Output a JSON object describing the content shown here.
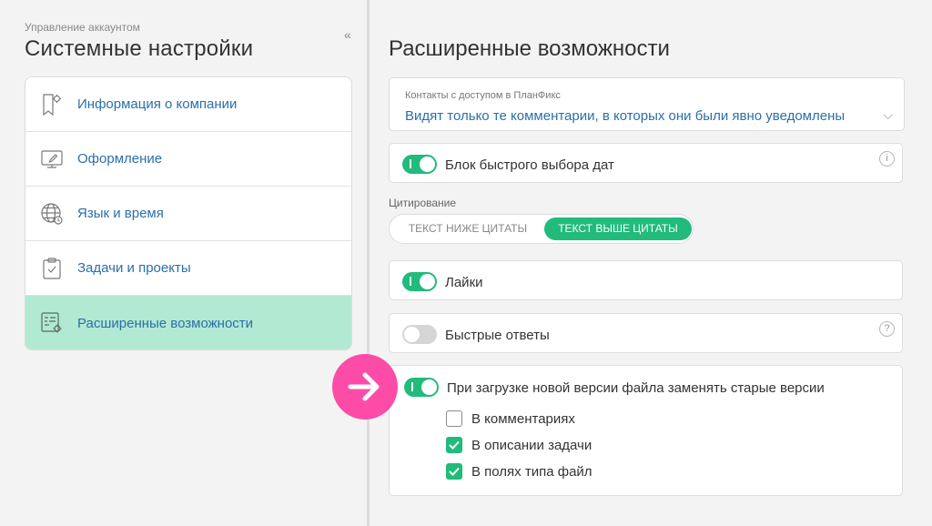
{
  "left": {
    "breadcrumb": "Управление аккаунтом",
    "collapse_glyph": "«",
    "title": "Системные настройки",
    "menu": [
      {
        "label": "Информация о компании",
        "icon": "company-info-icon",
        "active": false
      },
      {
        "label": "Оформление",
        "icon": "appearance-icon",
        "active": false
      },
      {
        "label": "Язык и время",
        "icon": "globe-icon",
        "active": false
      },
      {
        "label": "Задачи и проекты",
        "icon": "clipboard-check-icon",
        "active": false
      },
      {
        "label": "Расширенные возможности",
        "icon": "advanced-settings-icon",
        "active": true
      }
    ]
  },
  "right": {
    "title": "Расширенные возможности",
    "contacts_select": {
      "caption": "Контакты с доступом в ПланФикс",
      "value": "Видят только те комментарии, в которых они были явно уведомлены",
      "chevron": "⌵"
    },
    "quick_dates": {
      "label": "Блок быстрого выбора дат",
      "enabled": true,
      "help": "i"
    },
    "citation": {
      "caption": "Цитирование",
      "options": [
        "Текст ниже цитаты",
        "Текст выше цитаты"
      ],
      "selected": "Текст выше цитаты"
    },
    "likes": {
      "label": "Лайки",
      "enabled": true
    },
    "quick_replies": {
      "label": "Быстрые ответы",
      "enabled": false,
      "help": "?"
    },
    "file_versions": {
      "label": "При загрузке новой версии файла заменять старые версии",
      "enabled": true,
      "options": [
        {
          "label": "В комментариях",
          "checked": false
        },
        {
          "label": "В описании задачи",
          "checked": true
        },
        {
          "label": "В полях типа файл",
          "checked": true
        }
      ]
    }
  },
  "colors": {
    "accent_green": "#21bb7c",
    "active_menu_bg": "#b2e9d3",
    "link_blue": "#2b6fa8",
    "arrow_pink": "#fc4ca7"
  }
}
